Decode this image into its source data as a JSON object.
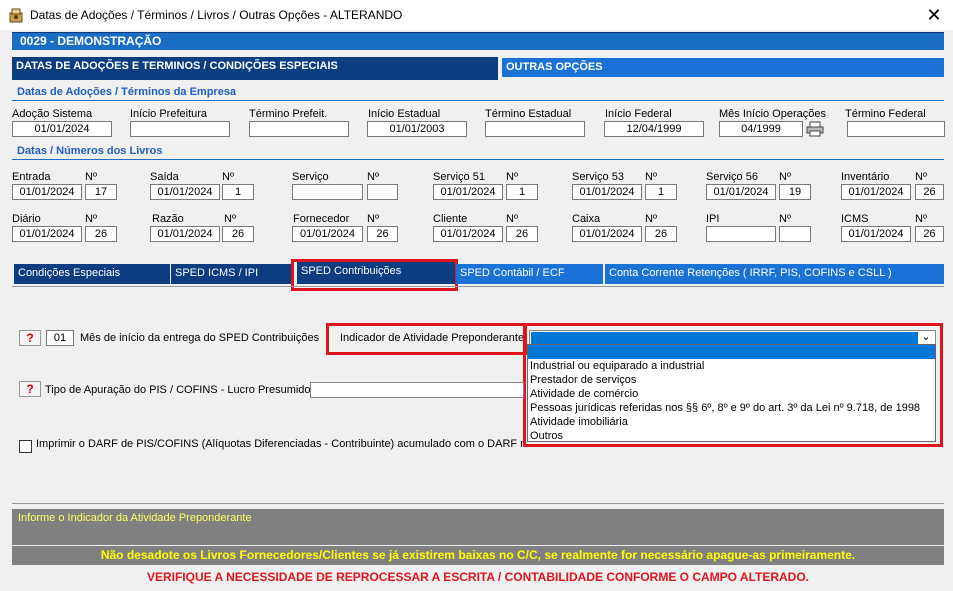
{
  "window": {
    "title": "Datas de Adoções / Términos / Livros / Outras Opções   -   ALTERANDO",
    "close_glyph": "✕"
  },
  "company": {
    "label": "0029   -   DEMONSTRAÇÃO"
  },
  "main_tabs": [
    {
      "label": "DATAS DE ADOÇÕES E TERMINOS / CONDIÇÕES ESPECIAIS"
    },
    {
      "label": "OUTRAS OPÇÕES"
    }
  ],
  "adocoes": {
    "title": "Datas de Adoções / Términos da Empresa",
    "fields": [
      {
        "label": "Adoção Sistema",
        "value": "01/01/2024"
      },
      {
        "label": "Início Prefeitura",
        "value": ""
      },
      {
        "label": "Término Prefeit.",
        "value": ""
      },
      {
        "label": "Início Estadual",
        "value": "01/01/2003"
      },
      {
        "label": "Término Estadual",
        "value": ""
      },
      {
        "label": "Início Federal",
        "value": "12/04/1999"
      },
      {
        "label": "Mês Início Operações",
        "value": "04/1999"
      },
      {
        "label": "Término Federal",
        "value": ""
      }
    ]
  },
  "livros": {
    "title": "Datas / Números dos Livros",
    "num_label": "Nº",
    "row1": [
      {
        "label": "Entrada",
        "date": "01/01/2024",
        "num": "17"
      },
      {
        "label": "Saída",
        "date": "01/01/2024",
        "num": "1"
      },
      {
        "label": "Serviço",
        "date": "",
        "num": ""
      },
      {
        "label": "Serviço 51",
        "date": "01/01/2024",
        "num": "1"
      },
      {
        "label": "Serviço 53",
        "date": "01/01/2024",
        "num": "1"
      },
      {
        "label": "Serviço 56",
        "date": "01/01/2024",
        "num": "19"
      },
      {
        "label": "Inventário",
        "date": "01/01/2024",
        "num": "26"
      }
    ],
    "row2": [
      {
        "label": "Diário",
        "date": "01/01/2024",
        "num": "26"
      },
      {
        "label": "Razão",
        "date": "01/01/2024",
        "num": "26"
      },
      {
        "label": "Fornecedor",
        "date": "01/01/2024",
        "num": "26"
      },
      {
        "label": "Cliente",
        "date": "01/01/2024",
        "num": "26"
      },
      {
        "label": "Caixa",
        "date": "01/01/2024",
        "num": "26"
      },
      {
        "label": "IPI",
        "date": "",
        "num": ""
      },
      {
        "label": "ICMS",
        "date": "01/01/2024",
        "num": "26"
      }
    ]
  },
  "sub_tabs": [
    {
      "label": "Condições Especiais"
    },
    {
      "label": "SPED ICMS / IPI"
    },
    {
      "label": "SPED Contribuições"
    },
    {
      "label": "SPED Contábil / ECF"
    },
    {
      "label": "Conta Corrente Retenções ( IRRF,  PIS,  COFINS  e  CSLL )"
    }
  ],
  "sped": {
    "help_glyph": "?",
    "mes_value": "01",
    "mes_label": "Mês de início da entrega do SPED Contribuições",
    "indicador_label": "Indicador de Atividade Preponderante",
    "tipo_label": "Tipo de Apuração do PIS / COFINS - Lucro Presumido:",
    "darf_label": "Imprimir o DARF de PIS/COFINS (Alíquotas Diferenciadas - Contribuinte) acumulado com o DARF norm",
    "dropdown_glyph": "⌄",
    "options": [
      "Industrial ou equiparado a industrial",
      "Prestador de serviços",
      "Atividade de comércio",
      "Pessoas jurídicas referidas nos §§ 6º, 8º e 9º do art. 3º da Lei nº 9.718, de 1998",
      "Atividade imobiliária",
      "Outros"
    ]
  },
  "footer": {
    "hint": "Informe o Indicador da Atividade Preponderante",
    "warning1": "Não desadote os Livros Fornecedores/Clientes se já existirem baixas no C/C, se realmente for necessário apague-as primeiramente.",
    "warning2": "VERIFIQUE A NECESSIDADE DE REPROCESSAR A ESCRITA / CONTABILIDADE CONFORME O CAMPO ALTERADO."
  },
  "colors": {
    "dark_blue": "#0b3d80",
    "blue": "#1a72d6",
    "highlight_red": "#e0141c",
    "selected_blue": "#0078d7",
    "footer_gray": "#808080"
  }
}
